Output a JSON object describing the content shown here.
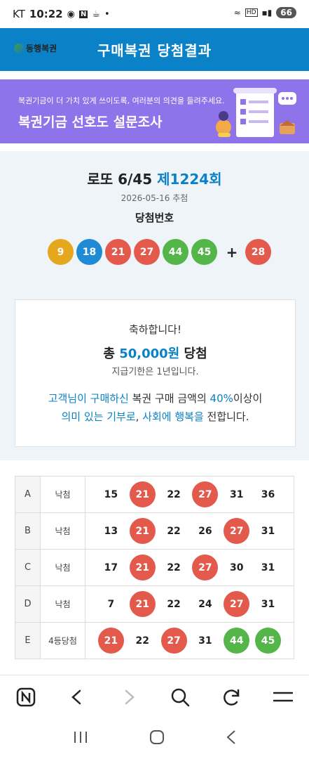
{
  "status_bar": {
    "carrier": "KT",
    "time": "10:22",
    "battery": "66"
  },
  "header": {
    "logo_text": "동행복권",
    "title": "구매복권 당첨결과"
  },
  "banner": {
    "subtitle": "복권기금이 더 가치 있게 쓰이도록, 여러분의 의견을 들려주세요.",
    "title": "복권기금 선호도 설문조사"
  },
  "draw": {
    "game": "로또 6/45",
    "round": "제1224회",
    "date": "2026-05-16 추첨",
    "label": "당첨번호",
    "numbers": [
      "9",
      "18",
      "21",
      "27",
      "44",
      "45"
    ],
    "plus": "+",
    "bonus": "28"
  },
  "result": {
    "congrats": "축하합니다!",
    "prize_prefix": "총",
    "prize_amount": "50,000원",
    "prize_suffix": "당첨",
    "deadline": "지급기한은 1년입니다.",
    "msg_hl1": "고객님이 구매하신",
    "msg_t1": " 복권 구매 금액의 ",
    "msg_hl2": "40%",
    "msg_t2": "이상이",
    "msg_hl3": "의미 있는 기부로",
    "msg_t3": ", ",
    "msg_hl4": "사회에 행복을",
    "msg_t4": " 전합니다."
  },
  "tickets": [
    {
      "letter": "A",
      "status": "낙첨",
      "numbers": [
        "15",
        "21",
        "22",
        "27",
        "31",
        "36"
      ]
    },
    {
      "letter": "B",
      "status": "낙첨",
      "numbers": [
        "13",
        "21",
        "22",
        "26",
        "27",
        "31"
      ]
    },
    {
      "letter": "C",
      "status": "낙첨",
      "numbers": [
        "17",
        "21",
        "22",
        "27",
        "30",
        "31"
      ]
    },
    {
      "letter": "D",
      "status": "낙첨",
      "numbers": [
        "7",
        "21",
        "22",
        "24",
        "27",
        "31"
      ]
    },
    {
      "letter": "E",
      "status": "4등당첨",
      "numbers": [
        "21",
        "22",
        "27",
        "31",
        "44",
        "45"
      ]
    }
  ],
  "colors": {
    "brand_blue": "#0b82c8",
    "banner_purple": "#8f73ea",
    "ball_yellow": "#e5a71e",
    "ball_blue": "#1f8bd4",
    "ball_red": "#e35a4d",
    "ball_green": "#54b548"
  },
  "browser_bar": {
    "icons": [
      "naver-icon",
      "back-icon",
      "forward-icon",
      "search-icon",
      "refresh-icon",
      "menu-icon"
    ]
  },
  "system_nav": {
    "icons": [
      "recent-apps-icon",
      "home-icon",
      "system-back-icon"
    ]
  }
}
